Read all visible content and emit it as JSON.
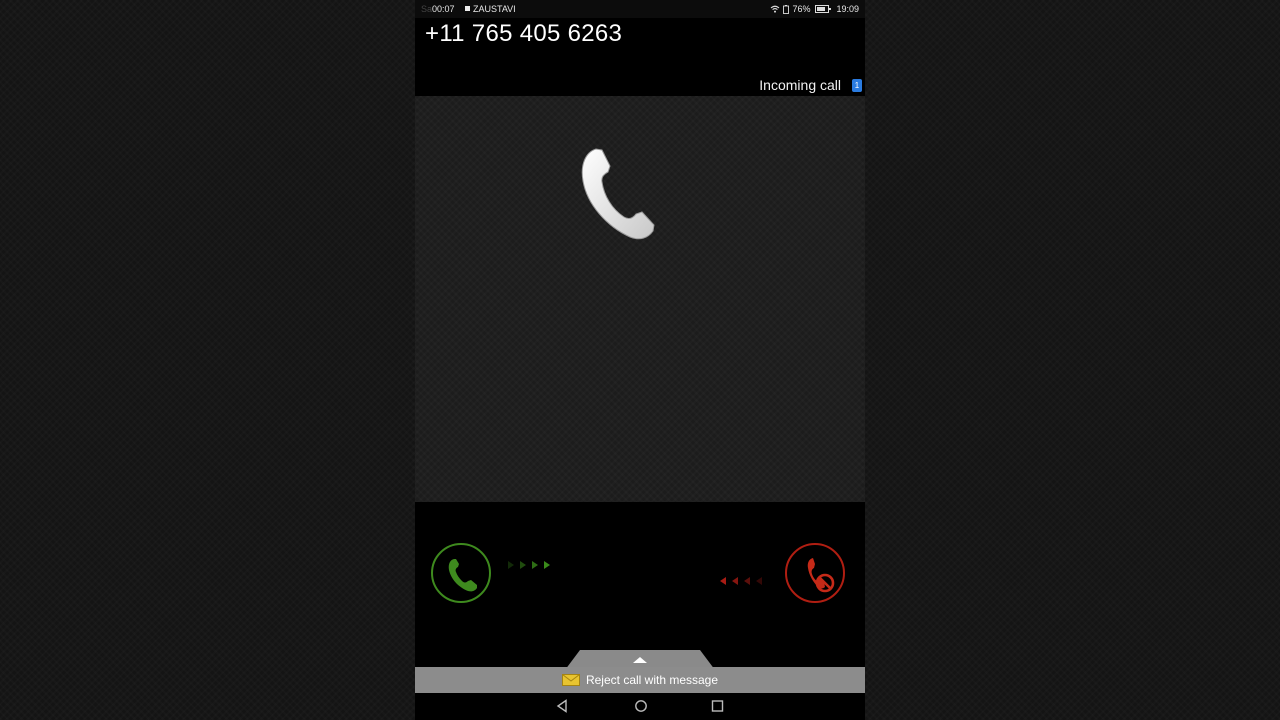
{
  "status_bar": {
    "ghost_text": "Sa",
    "recording_timer": "00:07",
    "recording_label": "ZAUSTAVI",
    "battery_percent": "76%",
    "time": "19:09"
  },
  "caller": {
    "number": "+11 765 405 6263"
  },
  "call_state": {
    "label": "Incoming call",
    "sim_slot": "1"
  },
  "reject_message": {
    "label": "Reject call with message"
  },
  "colors": {
    "answer": "#3e8a1e",
    "reject": "#b01e12",
    "sim_badge": "#2a7be0",
    "reject_bar": "#8c8c8c"
  },
  "icons": {
    "handset": "handset-icon",
    "answer": "answer-phone-icon",
    "reject": "reject-phone-icon",
    "envelope": "envelope-icon",
    "back": "back-icon",
    "home": "home-icon",
    "recents": "recents-icon"
  }
}
